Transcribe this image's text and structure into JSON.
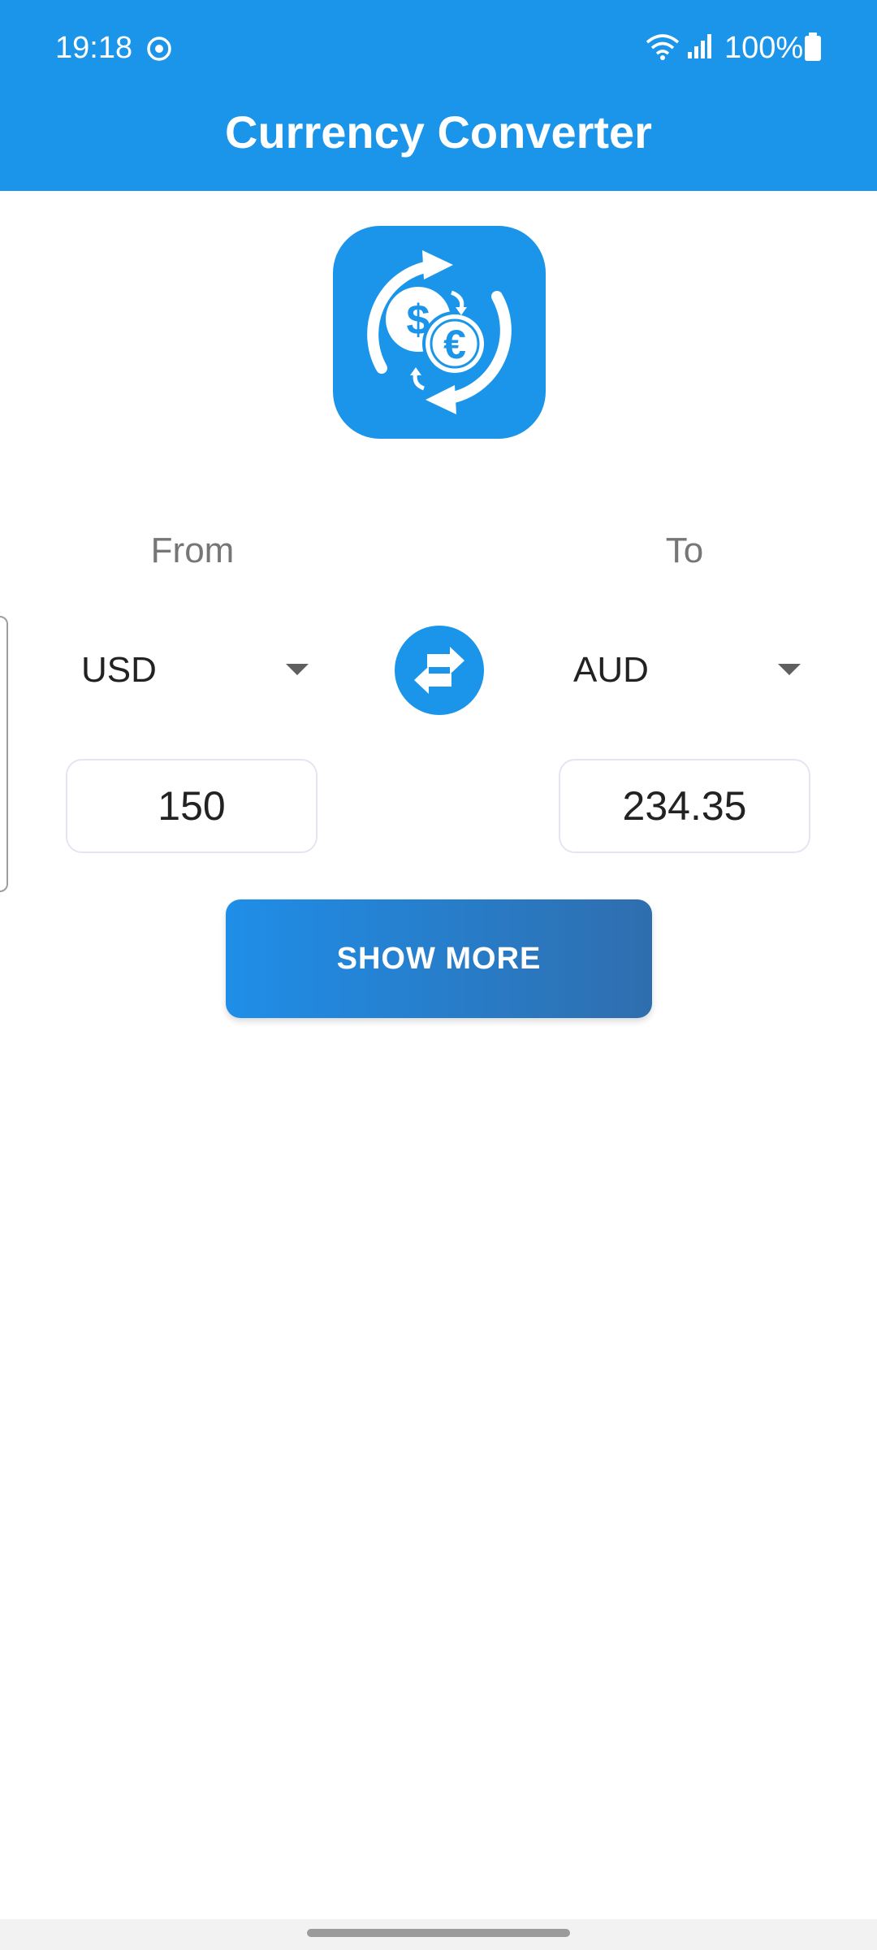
{
  "status_bar": {
    "time": "19:18",
    "battery": "100%",
    "icons": [
      "sync-icon",
      "wifi-icon",
      "signal-icon",
      "battery-icon"
    ]
  },
  "header": {
    "title": "Currency Converter"
  },
  "logo": {
    "icon": "currency-exchange-icon"
  },
  "converter": {
    "from_label": "From",
    "to_label": "To",
    "from_currency": "USD",
    "to_currency": "AUD",
    "from_amount": "150",
    "to_amount": "234.35",
    "swap_icon": "swap-arrows-icon"
  },
  "actions": {
    "show_more_label": "SHOW MORE"
  },
  "colors": {
    "primary": "#1b95ea",
    "button_gradient_start": "#1f8ee8",
    "button_gradient_end": "#2f6eae",
    "label_gray": "#767676",
    "field_border": "#e7e4f2"
  }
}
